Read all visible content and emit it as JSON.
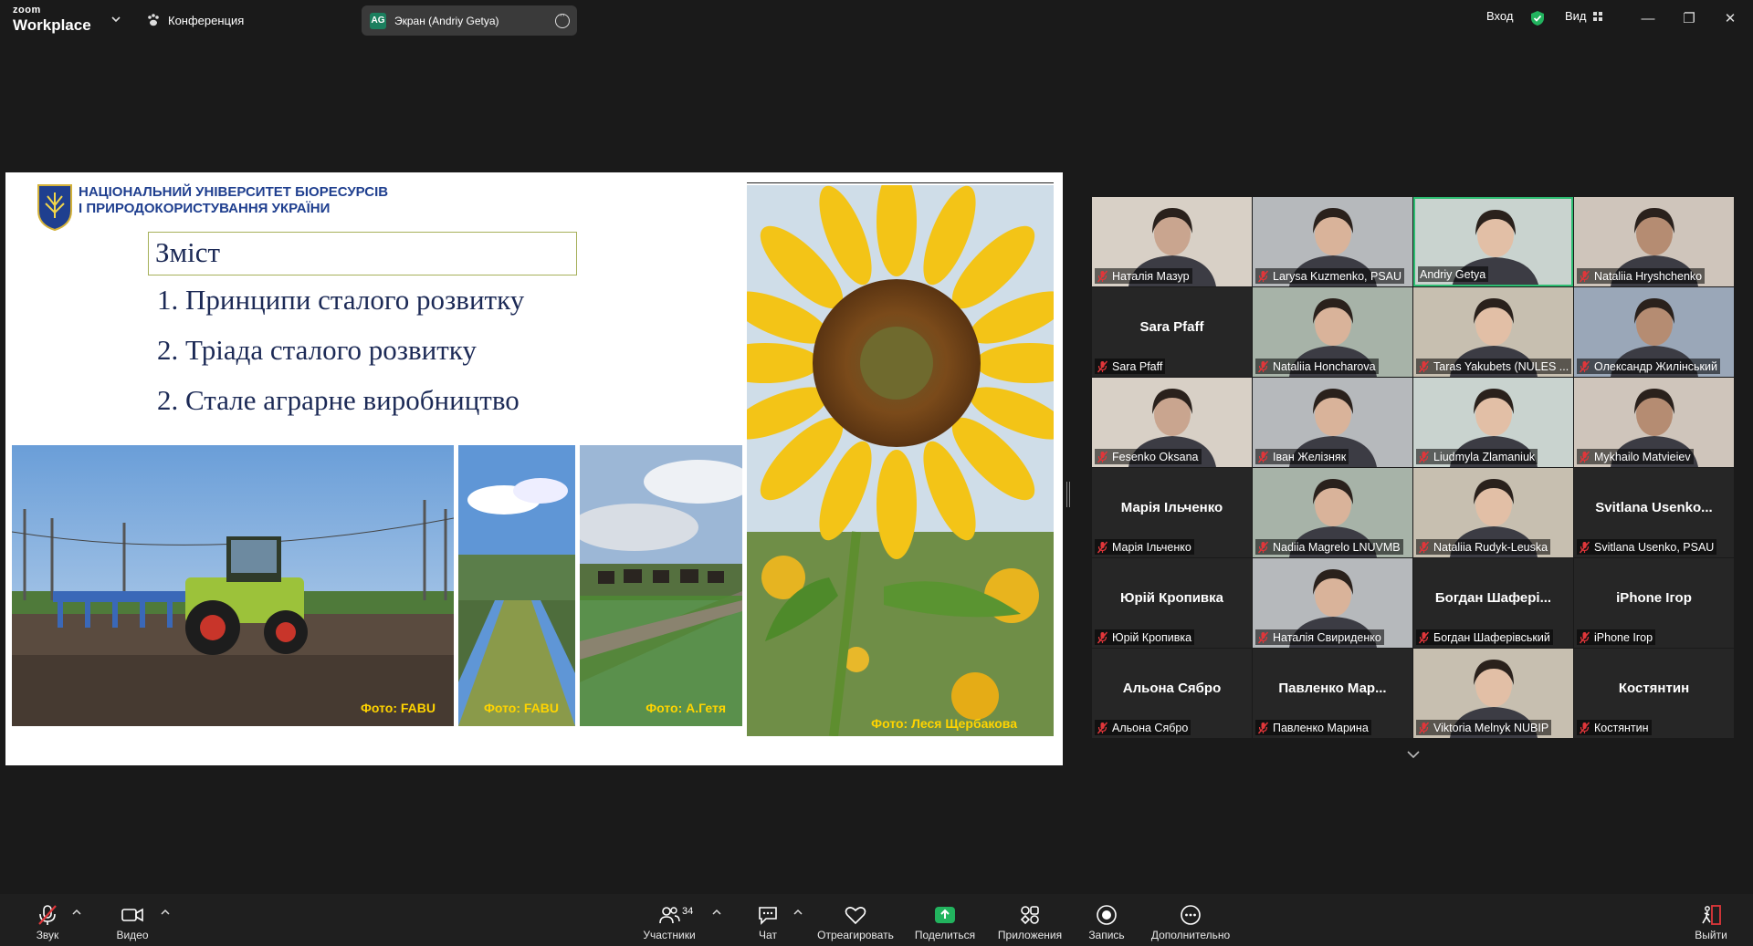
{
  "app": {
    "brand_top": "zoom",
    "brand_bottom": "Workplace",
    "meeting_label": "Конференция",
    "share_initials": "AG",
    "share_label": "Экран (Andriy Getya)",
    "signin_label": "Вход",
    "view_label": "Вид"
  },
  "slide": {
    "university": [
      "НАЦІОНАЛЬНИЙ УНІВЕРСИТЕТ БІОРЕСУРСІВ",
      "І ПРИРОДОКОРИСТУВАННЯ УКРАЇНИ"
    ],
    "toc_title": "Зміст",
    "items": [
      "1. Принципи сталого розвитку",
      "2. Тріада сталого розвитку",
      "2. Стале аграрне виробництво"
    ],
    "captions": [
      "Фото: FABU",
      "Фото: FABU",
      "Фото: А.Гетя",
      "Фото: Леся Щербакова"
    ]
  },
  "gallery": {
    "tiles": [
      {
        "name": "Наталія Мазур",
        "big": "",
        "video": true,
        "muted": true,
        "active": false
      },
      {
        "name": "Larysa Kuzmenko, PSAU",
        "big": "",
        "video": true,
        "muted": true,
        "active": false
      },
      {
        "name": "Andriy Getya",
        "big": "",
        "video": true,
        "muted": false,
        "active": true
      },
      {
        "name": "Nataliia Hryshchenko",
        "big": "",
        "video": true,
        "muted": true,
        "active": false
      },
      {
        "name": "Sara Pfaff",
        "big": "Sara Pfaff",
        "video": false,
        "muted": true,
        "active": false
      },
      {
        "name": "Nataliia Honcharova",
        "big": "",
        "video": true,
        "muted": true,
        "active": false
      },
      {
        "name": "Taras Yakubets (NULES ...",
        "big": "",
        "video": true,
        "muted": true,
        "active": false
      },
      {
        "name": "Олександр Жилінський",
        "big": "",
        "video": true,
        "muted": true,
        "active": false
      },
      {
        "name": "Fesenko Oksana",
        "big": "",
        "video": true,
        "muted": true,
        "active": false
      },
      {
        "name": "Іван Желізняк",
        "big": "",
        "video": true,
        "muted": true,
        "active": false
      },
      {
        "name": "Liudmyla Zlamaniuk",
        "big": "",
        "video": true,
        "muted": true,
        "active": false
      },
      {
        "name": "Mykhailo Matvieiev",
        "big": "",
        "video": true,
        "muted": true,
        "active": false
      },
      {
        "name": "Марія Ільченко",
        "big": "Марія Ільченко",
        "video": false,
        "muted": true,
        "active": false
      },
      {
        "name": "Nadiia Magrelo LNUVMB",
        "big": "",
        "video": true,
        "muted": true,
        "active": false
      },
      {
        "name": "Nataliia Rudyk-Leuska",
        "big": "",
        "video": true,
        "muted": true,
        "active": false
      },
      {
        "name": "Svitlana Usenko, PSAU",
        "big": "Svitlana  Usenko...",
        "video": false,
        "muted": true,
        "active": false
      },
      {
        "name": "Юрій Кропивка",
        "big": "Юрій Кропивка",
        "video": false,
        "muted": true,
        "active": false
      },
      {
        "name": "Наталія Свириденко",
        "big": "",
        "video": true,
        "muted": true,
        "active": false
      },
      {
        "name": "Богдан Шаферівський",
        "big": "Богдан  Шафері...",
        "video": false,
        "muted": true,
        "active": false
      },
      {
        "name": "iPhone Ігор",
        "big": "iPhone Ігор",
        "video": false,
        "muted": true,
        "active": false
      },
      {
        "name": "Альона Сябро",
        "big": "Альона Сябро",
        "video": false,
        "muted": true,
        "active": false
      },
      {
        "name": "Павленко Марина",
        "big": "Павленко  Мар...",
        "video": false,
        "muted": true,
        "active": false
      },
      {
        "name": "Viktoria Melnyk NUBIP",
        "big": "",
        "video": true,
        "muted": true,
        "active": false
      },
      {
        "name": "Костянтин",
        "big": "Костянтин",
        "video": false,
        "muted": true,
        "active": false
      }
    ]
  },
  "toolbar": {
    "audio": "Звук",
    "video": "Видео",
    "participants": "Участники",
    "participants_count": "34",
    "chat": "Чат",
    "react": "Отреагировать",
    "share": "Поделиться",
    "apps": "Приложения",
    "record": "Запись",
    "more": "Дополнительно",
    "leave": "Выйти"
  },
  "colors": {
    "active_speaker": "#2ebd72",
    "share_green": "#22b35e",
    "muted_red": "#e0363a",
    "caption_yellow": "#ffd400"
  }
}
